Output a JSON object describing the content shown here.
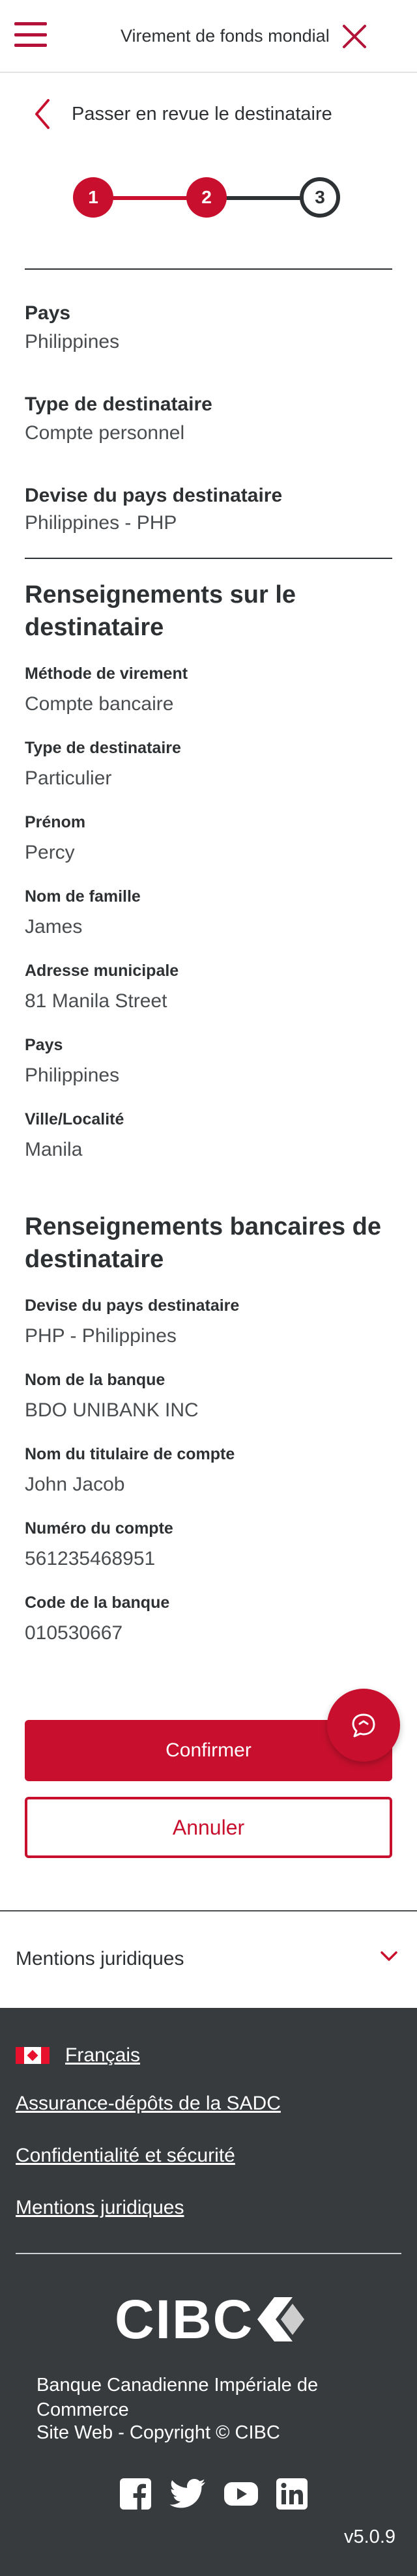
{
  "header": {
    "title": "Virement de fonds mondial",
    "back_label": "Passer en revue le destinataire"
  },
  "stepper": {
    "steps": [
      "1",
      "2",
      "3"
    ],
    "current": 3
  },
  "summary": {
    "country_label": "Pays",
    "country_value": "Philippines",
    "type_label": "Type de destinataire",
    "type_value": "Compte personnel",
    "currency_label": "Devise du pays destinataire",
    "currency_value": "Philippines - PHP"
  },
  "recipient": {
    "title": "Renseignements sur le destinataire",
    "fields": [
      {
        "label": "Méthode de virement",
        "value": "Compte bancaire"
      },
      {
        "label": "Type de destinataire",
        "value": "Particulier"
      },
      {
        "label": "Prénom",
        "value": "Percy"
      },
      {
        "label": "Nom de famille",
        "value": "James"
      },
      {
        "label": "Adresse municipale",
        "value": "81 Manila Street"
      },
      {
        "label": "Pays",
        "value": "Philippines"
      },
      {
        "label": "Ville/Localité",
        "value": "Manila"
      }
    ]
  },
  "bank": {
    "title": "Renseignements bancaires de destinataire",
    "fields": [
      {
        "label": "Devise du pays destinataire",
        "value": "PHP - Philippines"
      },
      {
        "label": "Nom de la banque",
        "value": "BDO UNIBANK INC"
      },
      {
        "label": "Nom du titulaire de compte",
        "value": "John Jacob"
      },
      {
        "label": "Numéro du compte",
        "value": "561235468951"
      },
      {
        "label": "Code de la banque",
        "value": "010530667"
      }
    ]
  },
  "actions": {
    "confirm_label": "Confirmer",
    "cancel_label": "Annuler",
    "chat_icon": "chat-icon"
  },
  "legal": {
    "label": "Mentions juridiques"
  },
  "footer": {
    "language": "Français",
    "links": [
      "Assurance-dépôts de la SADC",
      "Confidentialité et sécurité",
      "Mentions juridiques"
    ],
    "logo_text": "CIBC",
    "bank_name": "Banque Canadienne Impériale de Commerce",
    "website": "Site Web - Copyright © CIBC",
    "socials": [
      "facebook-icon",
      "twitter-icon",
      "youtube-icon",
      "linkedin-icon"
    ],
    "version": "v5.0.9"
  },
  "colors": {
    "brand": "#c8102e",
    "text": "#2e3133",
    "footer_bg": "#383b3e"
  }
}
